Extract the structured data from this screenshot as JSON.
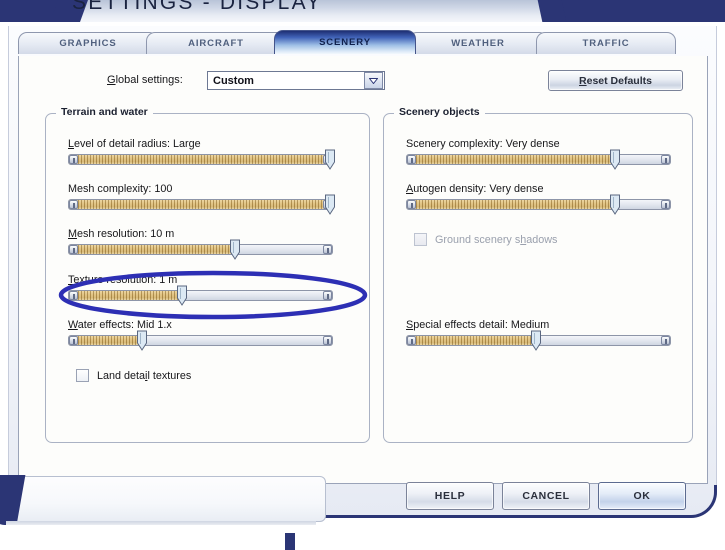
{
  "window": {
    "title": "SETTINGS - DISPLAY"
  },
  "tabs": [
    {
      "label": "GRAPHICS",
      "selected": false
    },
    {
      "label": "AIRCRAFT",
      "selected": false
    },
    {
      "label": "SCENERY",
      "selected": true
    },
    {
      "label": "WEATHER",
      "selected": false
    },
    {
      "label": "TRAFFIC",
      "selected": false
    }
  ],
  "global_settings": {
    "label_pre": "G",
    "label_post": "lobal settings:",
    "value": "Custom",
    "dropdown_icon": "chevron-down-icon"
  },
  "reset_button": {
    "pre": "R",
    "post": "eset Defaults"
  },
  "groups": {
    "terrain": {
      "title": "Terrain and water",
      "controls": [
        {
          "kind": "slider",
          "name": "level-of-detail-radius",
          "label_pre": "L",
          "label_post": "evel of detail radius: Large",
          "value_text": "Large",
          "percent": 99
        },
        {
          "kind": "slider",
          "name": "mesh-complexity",
          "label_pre": "Mesh c",
          "label_post": "omplexity: 100",
          "value_text": "100",
          "percent": 99
        },
        {
          "kind": "slider",
          "name": "mesh-resolution",
          "label_pre": "M",
          "label_post": "esh resolution: 10 m",
          "value_text": "10 m",
          "percent": 63
        },
        {
          "kind": "slider",
          "name": "texture-resolution",
          "label_pre": "T",
          "label_post": "exture resolution: 1 m",
          "value_text": "1 m",
          "percent": 43
        },
        {
          "kind": "slider",
          "name": "water-effects",
          "label_pre": "W",
          "label_post": "ater effects: Mid 1.x",
          "value_text": "Mid 1.x",
          "percent": 28
        },
        {
          "kind": "checkbox",
          "name": "land-detail-textures",
          "text_pre": "Land deta",
          "text_mid": "i",
          "text_post": "l textures",
          "checked": false,
          "disabled": false
        }
      ]
    },
    "scenery": {
      "title": "Scenery objects",
      "controls": [
        {
          "kind": "slider",
          "name": "scenery-complexity",
          "label_pre": "Scenery comple",
          "label_post": "xity: Very dense",
          "value_text": "Very dense",
          "percent": 79
        },
        {
          "kind": "slider",
          "name": "autogen-density",
          "label_pre": "A",
          "label_post": "utogen density: Very dense",
          "value_text": "Very dense",
          "percent": 79
        },
        {
          "kind": "checkbox",
          "name": "ground-scenery-shadows",
          "text_pre": "Ground scenery s",
          "text_mid": "h",
          "text_post": "adows",
          "checked": false,
          "disabled": true
        },
        {
          "kind": "slider",
          "name": "special-effects-detail",
          "label_pre": "S",
          "label_post": "pecial effects detail: Medium",
          "value_text": "Medium",
          "percent": 49
        }
      ]
    }
  },
  "footer_buttons": [
    {
      "label": "HELP",
      "focused": false
    },
    {
      "label": "CANCEL",
      "focused": false
    },
    {
      "label": "OK",
      "focused": true
    }
  ],
  "annotation": {
    "shape": "ellipse-highlight",
    "color": "#2d2fb4",
    "targets": "mesh-resolution"
  },
  "colors": {
    "accent_navy": "#2b3575",
    "slider_fill": "#d8b877",
    "tab_selected_top": "#1e2f73",
    "annotation": "#2d2fb4"
  }
}
